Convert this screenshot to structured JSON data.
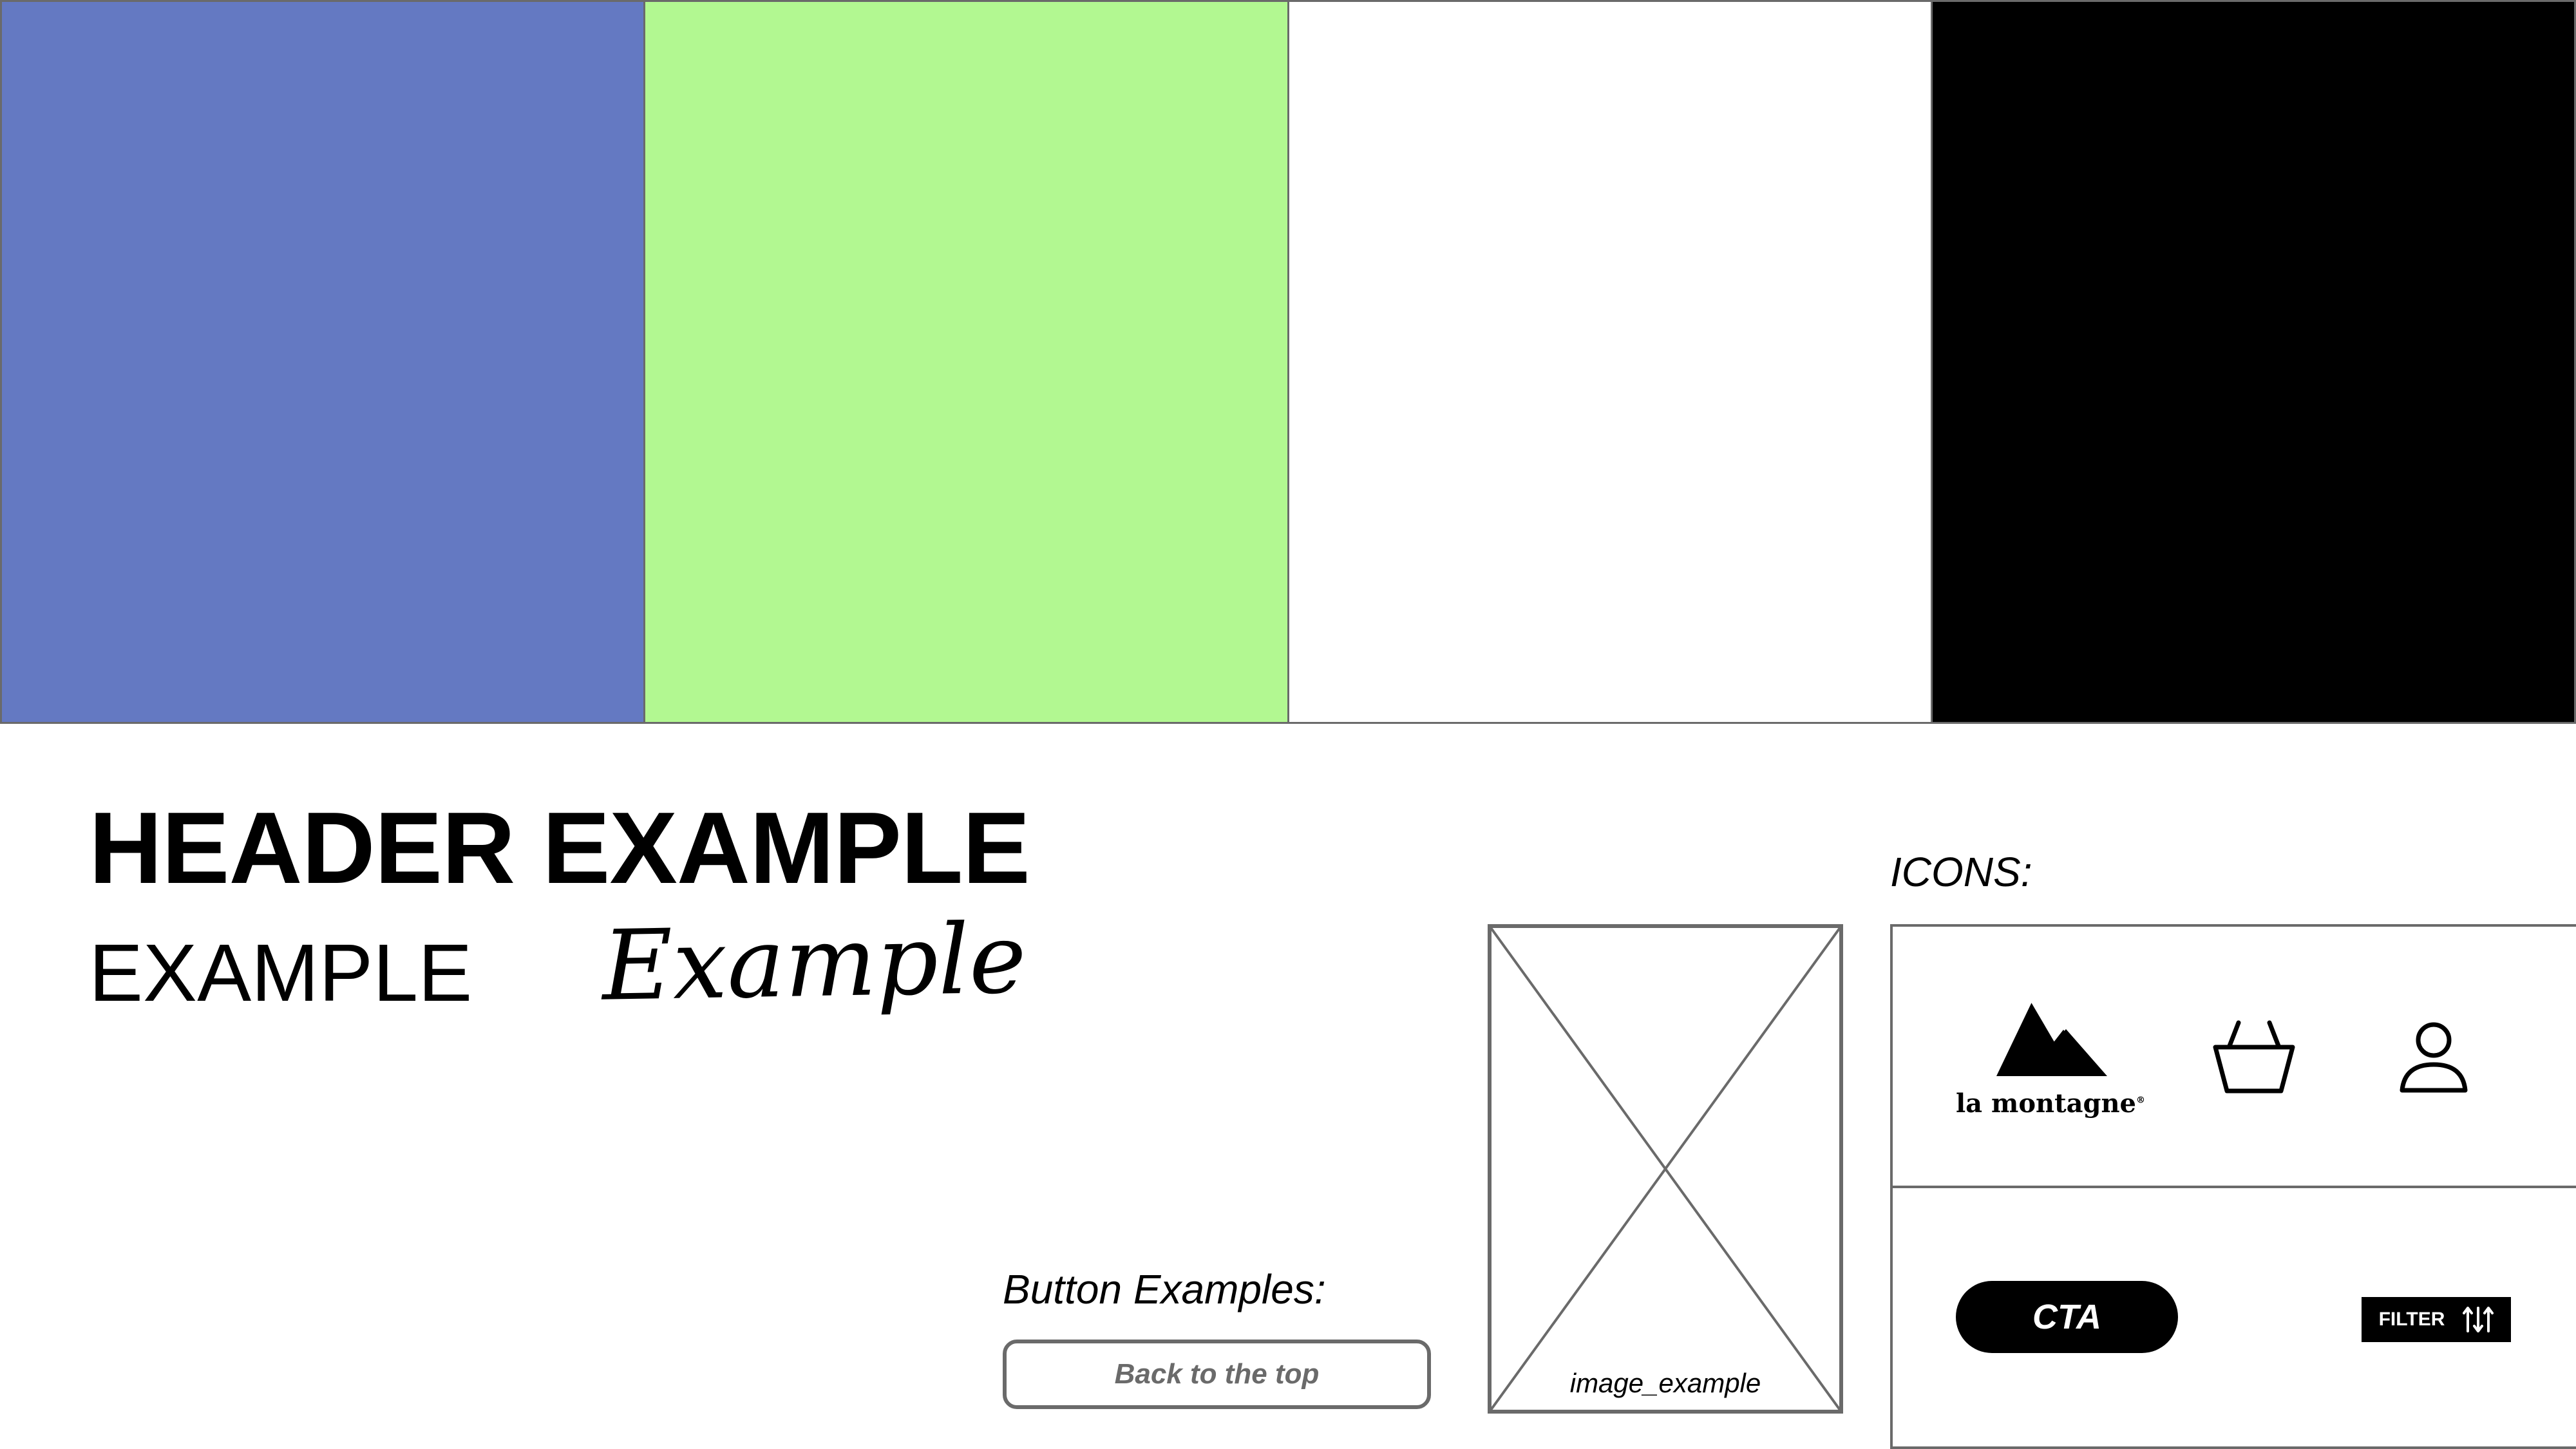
{
  "palette": {
    "colors": [
      "#6479c2",
      "#b2f891",
      "#ffffff",
      "#000000"
    ]
  },
  "typography": {
    "header_example": "HEADER EXAMPLE",
    "example_regular": "EXAMPLE",
    "example_script": "Example"
  },
  "buttons": {
    "section_label": "Button Examples:",
    "back_to_top_label": "Back to the top"
  },
  "image_placeholder": {
    "caption": "image_example"
  },
  "icons": {
    "section_label": "ICONS:",
    "brand_name": "la montagne",
    "brand_mark": "®",
    "brand_icon": "mountain-icon",
    "basket_icon": "basket-icon",
    "user_icon": "user-icon",
    "cta_label": "CTA",
    "filter_label": "FILTER",
    "filter_icon": "sort-arrows-icon"
  },
  "colors": {
    "border_gray": "#6a6a6a",
    "button_text_gray": "#6a6a6a",
    "dark": "#000000"
  }
}
